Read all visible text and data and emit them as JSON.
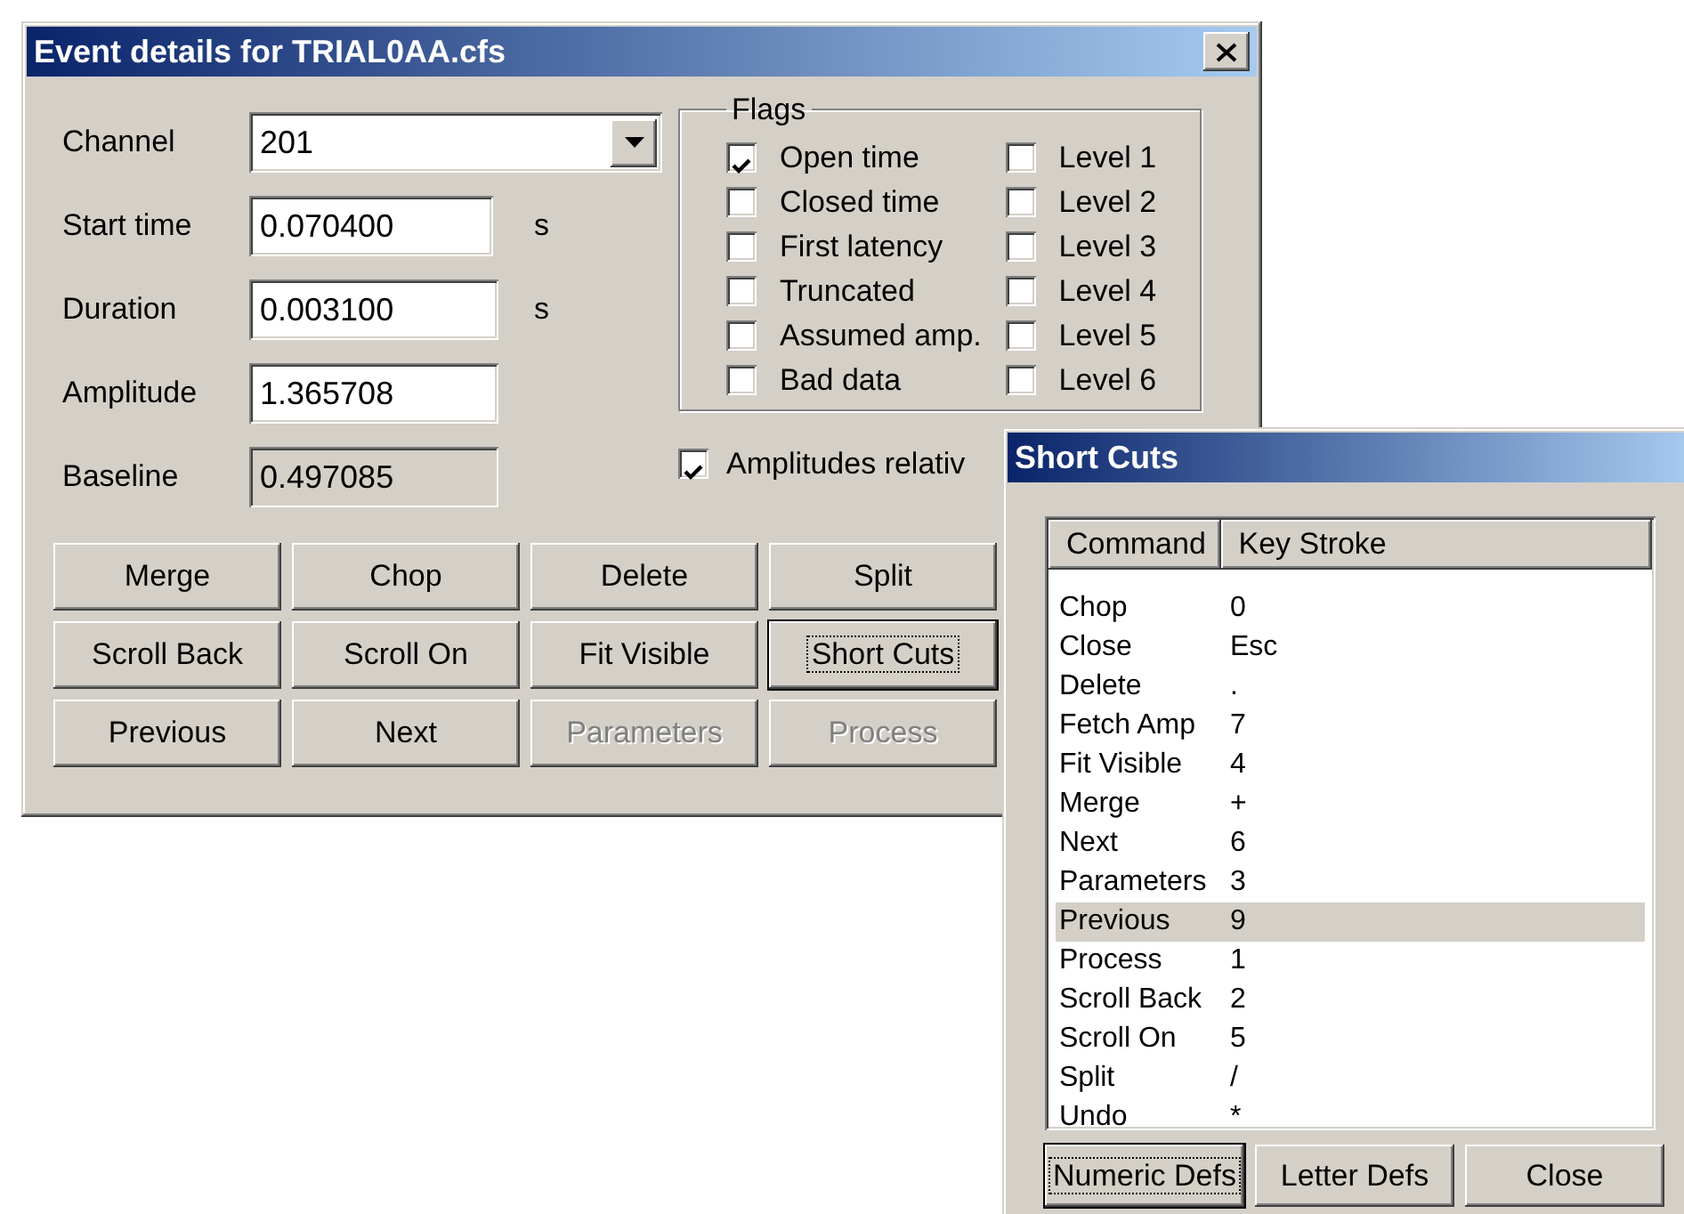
{
  "event_window": {
    "title": "Event details for TRIAL0AA.cfs",
    "fields": [
      {
        "label": "Channel",
        "kind": "combo",
        "value": "201",
        "disabled": false
      },
      {
        "label": "Start time",
        "kind": "text",
        "value": "0.070400",
        "unit": "s",
        "disabled": false
      },
      {
        "label": "Duration",
        "kind": "text",
        "value": "0.003100",
        "unit": "s",
        "disabled": false
      },
      {
        "label": "Amplitude",
        "kind": "text",
        "value": "1.365708",
        "disabled": false
      },
      {
        "label": "Baseline",
        "kind": "text",
        "value": "0.497085",
        "disabled": true
      }
    ],
    "flags": {
      "title": "Flags",
      "columns": [
        [
          {
            "label": "Open time",
            "checked": true
          },
          {
            "label": "Closed time",
            "checked": false
          },
          {
            "label": "First latency",
            "checked": false
          },
          {
            "label": "Truncated",
            "checked": false
          },
          {
            "label": "Assumed amp.",
            "checked": false
          },
          {
            "label": "Bad data",
            "checked": false
          }
        ],
        [
          {
            "label": "Level 1",
            "checked": false
          },
          {
            "label": "Level 2",
            "checked": false
          },
          {
            "label": "Level 3",
            "checked": false
          },
          {
            "label": "Level 4",
            "checked": false
          },
          {
            "label": "Level 5",
            "checked": false
          },
          {
            "label": "Level 6",
            "checked": false
          }
        ]
      ]
    },
    "relative_checkbox": {
      "label": "Amplitudes relativ",
      "checked": true
    },
    "buttons": [
      {
        "label": "Merge",
        "disabled": false,
        "focused": false
      },
      {
        "label": "Chop",
        "disabled": false,
        "focused": false
      },
      {
        "label": "Delete",
        "disabled": false,
        "focused": false
      },
      {
        "label": "Split",
        "disabled": false,
        "focused": false
      },
      {
        "label": "Scroll Back",
        "disabled": false,
        "focused": false
      },
      {
        "label": "Scroll On",
        "disabled": false,
        "focused": false
      },
      {
        "label": "Fit Visible",
        "disabled": false,
        "focused": false
      },
      {
        "label": "Short Cuts",
        "disabled": false,
        "focused": true
      },
      {
        "label": "Previous",
        "disabled": false,
        "focused": false
      },
      {
        "label": "Next",
        "disabled": false,
        "focused": false
      },
      {
        "label": "Parameters",
        "disabled": true,
        "focused": false
      },
      {
        "label": "Process",
        "disabled": true,
        "focused": false
      }
    ]
  },
  "shortcuts_window": {
    "title": "Short Cuts",
    "columns": [
      "Command",
      "Key Stroke"
    ],
    "rows": [
      {
        "command": "Chop",
        "key": "0",
        "selected": false
      },
      {
        "command": "Close",
        "key": "Esc",
        "selected": false
      },
      {
        "command": "Delete",
        "key": ".",
        "selected": false
      },
      {
        "command": "Fetch Amp",
        "key": "7",
        "selected": false
      },
      {
        "command": "Fit Visible",
        "key": "4",
        "selected": false
      },
      {
        "command": "Merge",
        "key": "+",
        "selected": false
      },
      {
        "command": "Next",
        "key": "6",
        "selected": false
      },
      {
        "command": "Parameters",
        "key": "3",
        "selected": false
      },
      {
        "command": "Previous",
        "key": "9",
        "selected": true
      },
      {
        "command": "Process",
        "key": "1",
        "selected": false
      },
      {
        "command": "Scroll Back",
        "key": "2",
        "selected": false
      },
      {
        "command": "Scroll On",
        "key": "5",
        "selected": false
      },
      {
        "command": "Split",
        "key": "/",
        "selected": false
      },
      {
        "command": "Undo",
        "key": "*",
        "selected": false
      }
    ],
    "buttons": [
      {
        "label": "Numeric Defs",
        "focused": true
      },
      {
        "label": "Letter Defs",
        "focused": false
      },
      {
        "label": "Close",
        "focused": false
      }
    ]
  }
}
